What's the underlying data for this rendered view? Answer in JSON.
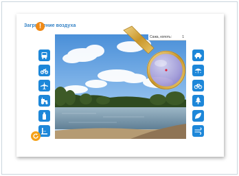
{
  "page": {
    "title": "Загрязнение воздуха"
  },
  "alert": {
    "glyph": "!",
    "icon": "alert-icon"
  },
  "left_tools": [
    {
      "name": "bus",
      "icon": "bus-icon"
    },
    {
      "name": "motorcycle",
      "icon": "motorcycle-icon"
    },
    {
      "name": "airplane",
      "icon": "airplane-icon"
    },
    {
      "name": "tractor",
      "icon": "tractor-icon"
    },
    {
      "name": "spray-can",
      "icon": "spray-can-icon"
    },
    {
      "name": "factory",
      "icon": "factory-icon"
    }
  ],
  "right_tools": [
    {
      "name": "car",
      "icon": "car-icon"
    },
    {
      "name": "rain",
      "icon": "rain-icon"
    },
    {
      "name": "bicycle",
      "icon": "bicycle-icon"
    },
    {
      "name": "tree",
      "icon": "tree-icon"
    },
    {
      "name": "leaf",
      "icon": "leaf-icon"
    },
    {
      "name": "wind",
      "icon": "wind-icon"
    }
  ],
  "readout": {
    "label": "Сажа, копоть:",
    "value": "1"
  },
  "colors": {
    "accent": "#1d87d9",
    "title": "#2f7fc4",
    "alert": "#f08a16",
    "loupe_rim": "#d2a12a",
    "refresh": "#f5a21a"
  }
}
